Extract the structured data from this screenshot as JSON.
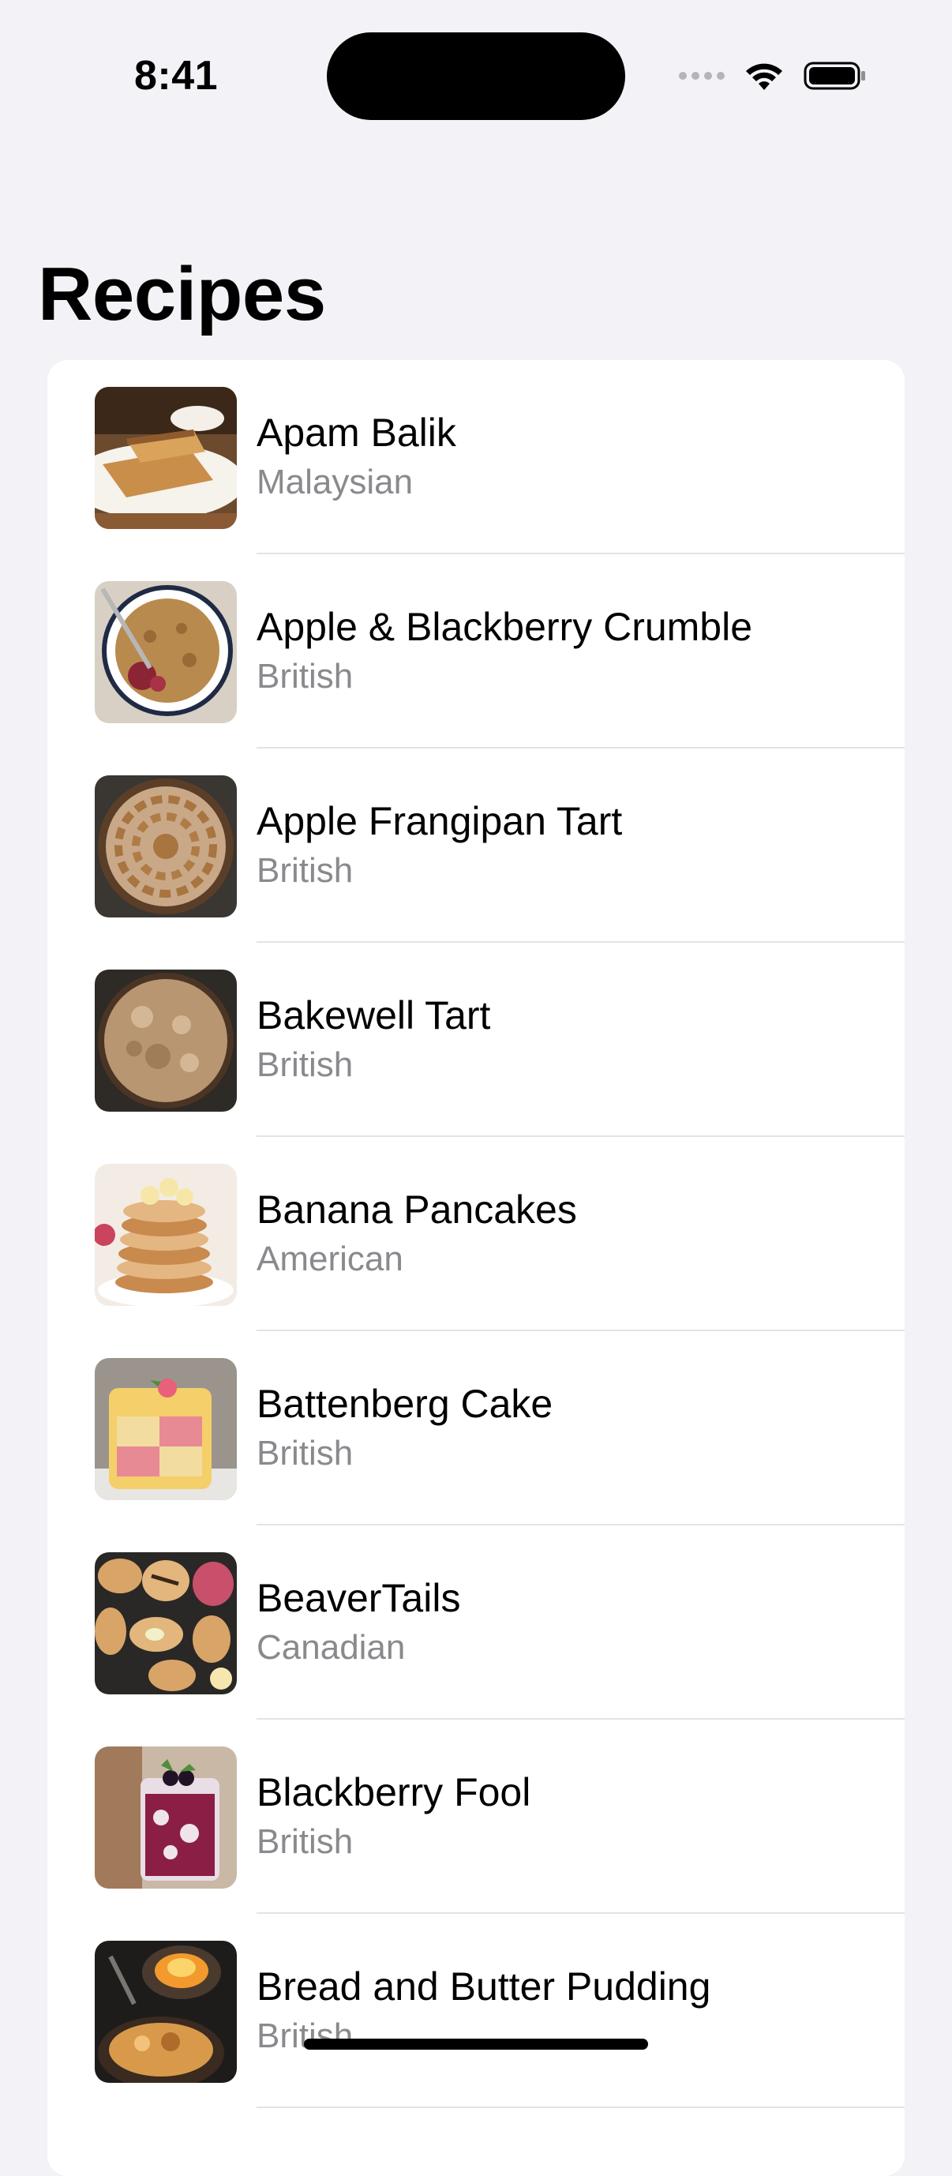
{
  "status_bar": {
    "time": "8:41",
    "signal_icon": "cellular-signal-icon",
    "wifi_icon": "wifi-icon",
    "battery_icon": "battery-icon"
  },
  "navigation": {
    "title": "Recipes"
  },
  "recipes": [
    {
      "name": "Apam Balik",
      "cuisine": "Malaysian",
      "image": "apam-balik-photo"
    },
    {
      "name": "Apple & Blackberry Crumble",
      "cuisine": "British",
      "image": "crumble-photo"
    },
    {
      "name": "Apple Frangipan Tart",
      "cuisine": "British",
      "image": "frangipan-tart-photo"
    },
    {
      "name": "Bakewell Tart",
      "cuisine": "British",
      "image": "bakewell-tart-photo"
    },
    {
      "name": "Banana Pancakes",
      "cuisine": "American",
      "image": "banana-pancakes-photo"
    },
    {
      "name": "Battenberg Cake",
      "cuisine": "British",
      "image": "battenberg-cake-photo"
    },
    {
      "name": "BeaverTails",
      "cuisine": "Canadian",
      "image": "beavertails-photo"
    },
    {
      "name": "Blackberry Fool",
      "cuisine": "British",
      "image": "blackberry-fool-photo"
    },
    {
      "name": "Bread and Butter Pudding",
      "cuisine": "British",
      "image": "bread-butter-pudding-photo"
    }
  ],
  "colors": {
    "background": "#f2f2f7",
    "card": "#ffffff",
    "secondary_text": "#8a8a8e",
    "separator": "#e3e3e8"
  }
}
